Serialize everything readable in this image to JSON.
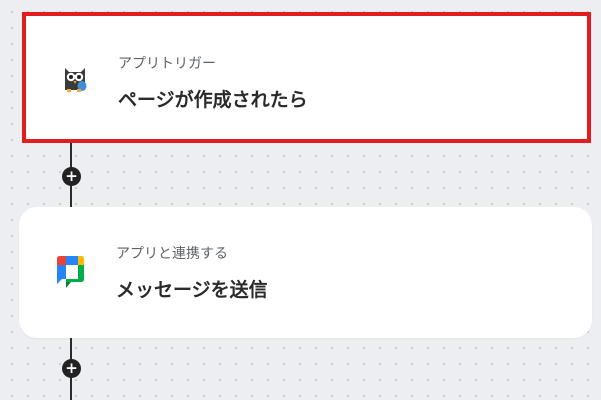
{
  "trigger_step": {
    "label": "アプリトリガー",
    "title": "ページが作成されたら",
    "icon": "owl-app-icon"
  },
  "action_step": {
    "label": "アプリと連携する",
    "title": "メッセージを送信",
    "icon": "google-chat-icon"
  },
  "add_step_button": {
    "label": "+"
  },
  "colors": {
    "selected_border": "#e11d1d",
    "canvas_background": "#edeef1",
    "connector": "#2b2b2b",
    "card_background": "#ffffff"
  }
}
